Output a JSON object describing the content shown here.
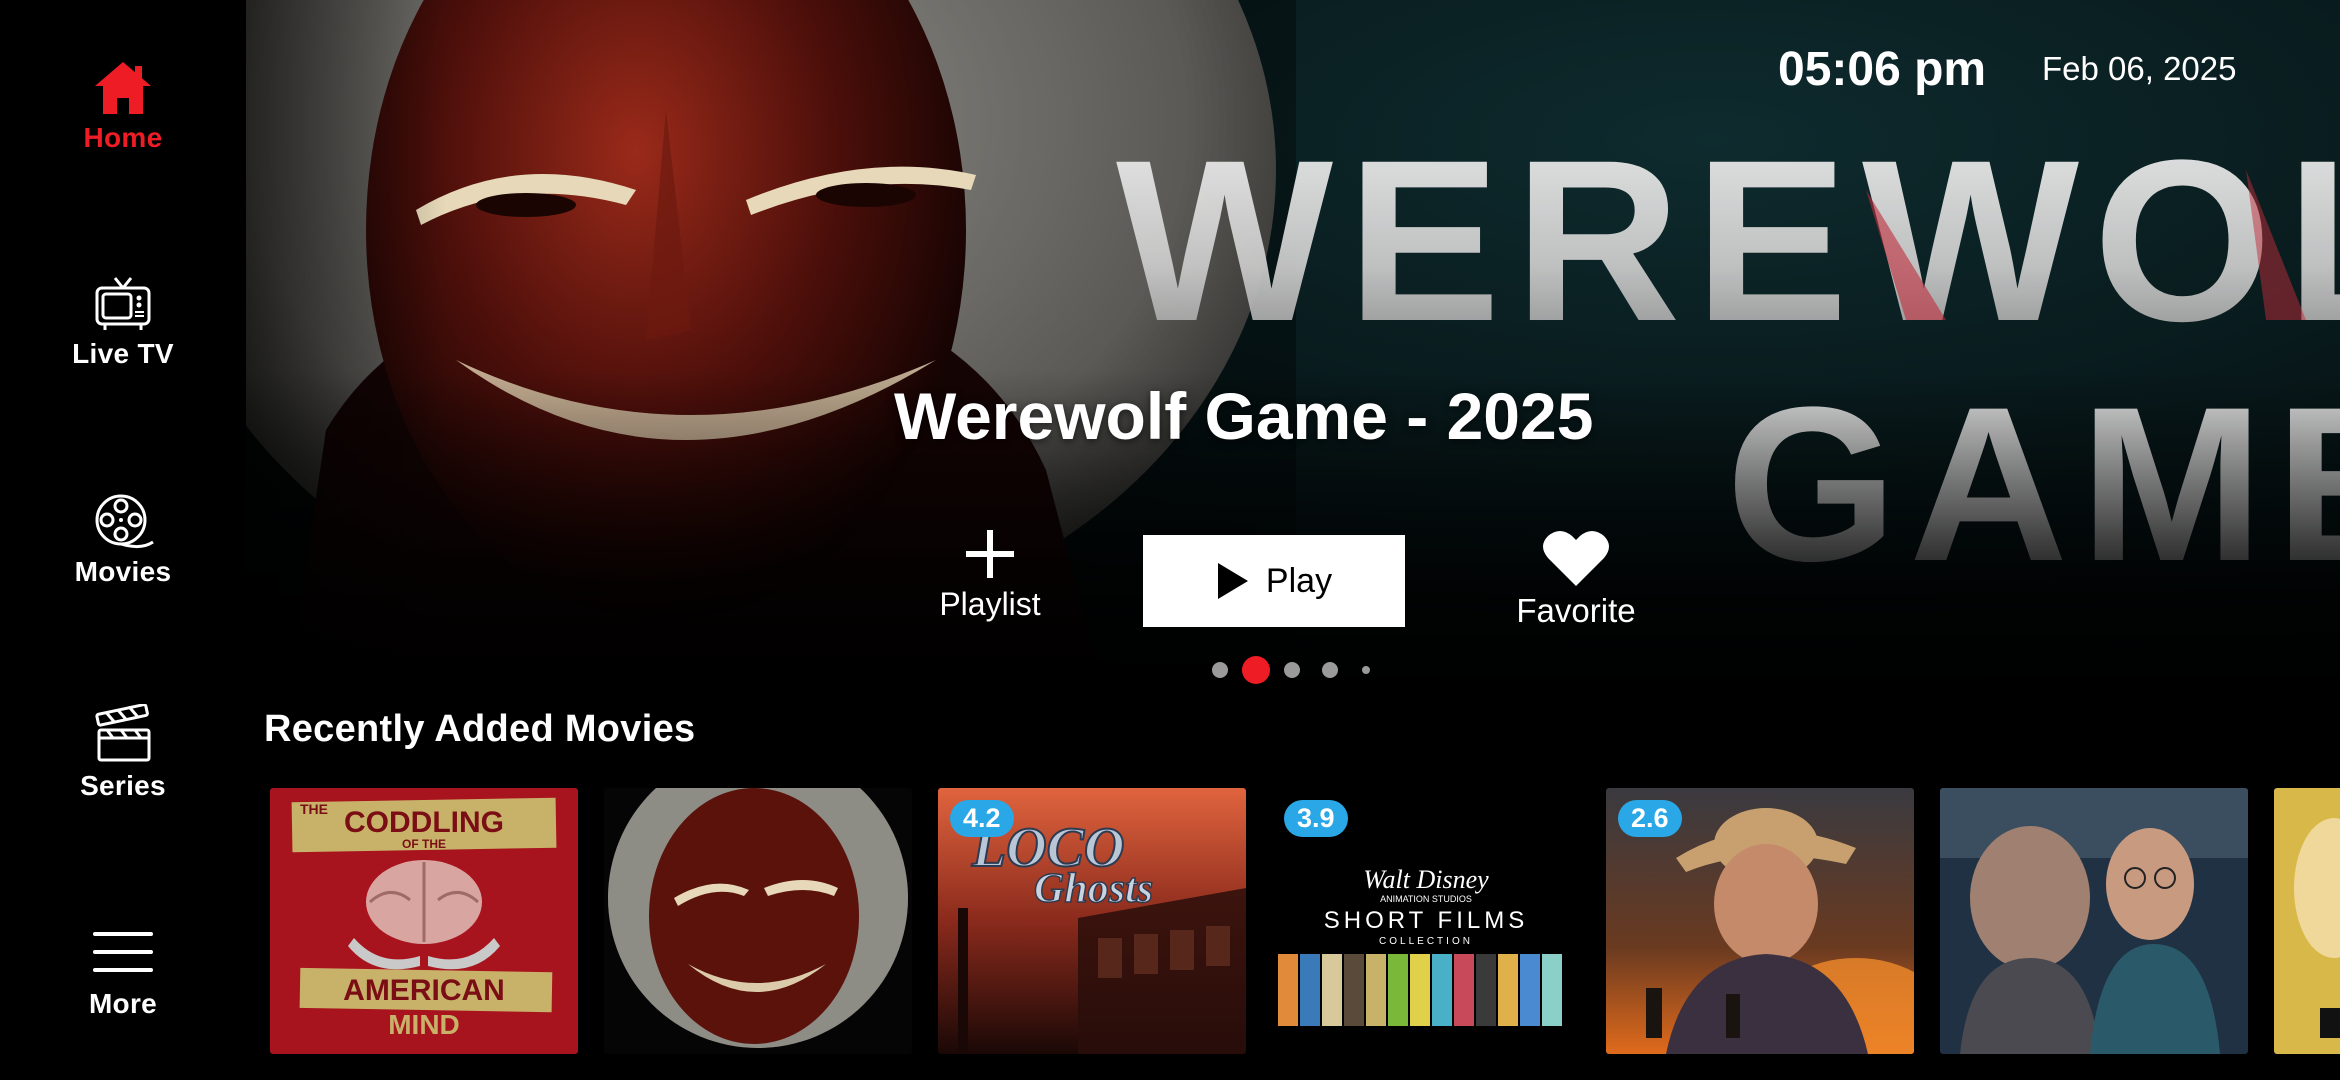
{
  "sidebar": {
    "items": [
      {
        "label": "Home",
        "icon": "home-icon",
        "active": true
      },
      {
        "label": "Live TV",
        "icon": "tv-icon",
        "active": false
      },
      {
        "label": "Movies",
        "icon": "film-reel-icon",
        "active": false
      },
      {
        "label": "Series",
        "icon": "clapperboard-icon",
        "active": false
      },
      {
        "label": "More",
        "icon": "hamburger-menu-icon",
        "active": false
      }
    ]
  },
  "header": {
    "time": "05:06 pm",
    "date": "Feb 06, 2025"
  },
  "hero": {
    "title": "Werewolf Game - 2025",
    "actions": {
      "playlist_label": "Playlist",
      "play_label": "Play",
      "favorite_label": "Favorite"
    },
    "carousel": {
      "count": 5,
      "active_index": 1
    }
  },
  "recently_added": {
    "title": "Recently Added Movies",
    "movies": [
      {
        "poster_texts": [
          "THE",
          "CODDLING",
          "OF THE",
          "AMERICAN",
          "MIND"
        ],
        "rating": null
      },
      {
        "rating": null
      },
      {
        "poster_texts": [
          "LOCO",
          "Ghosts"
        ],
        "rating": "4.2"
      },
      {
        "poster_texts": [
          "Walt Disney",
          "ANIMATION STUDIOS",
          "SHORT FILMS",
          "COLLECTION"
        ],
        "rating": "3.9"
      },
      {
        "rating": "2.6"
      },
      {
        "rating": null
      },
      {
        "rating": null
      }
    ]
  },
  "colors": {
    "accent": "#ee1c25",
    "rating_badge": "#2aa7e6",
    "background": "#000000"
  }
}
